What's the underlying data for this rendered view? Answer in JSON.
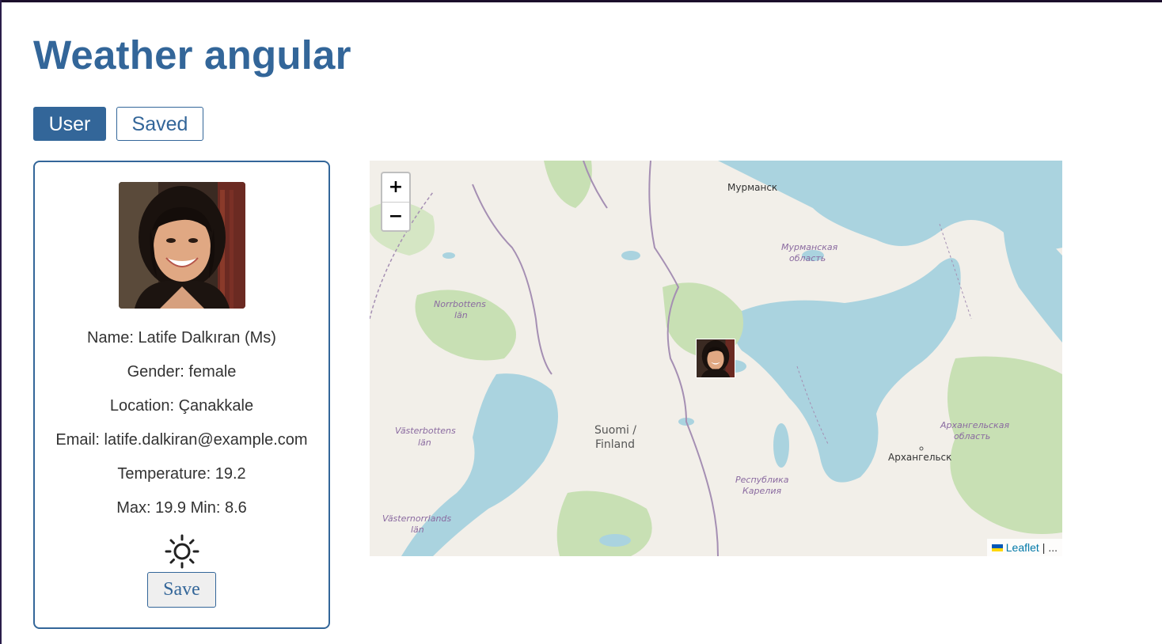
{
  "app": {
    "title": "Weather angular"
  },
  "tabs": {
    "user": "User",
    "saved": "Saved"
  },
  "user": {
    "name": "Name: Latife Dalkıran (Ms)",
    "gender": "Gender: female",
    "location": "Location: Çanakkale",
    "email": "Email: latife.dalkiran@example.com",
    "temperature": "Temperature: 19.2",
    "maxmin": "Max: 19.9 Min: 8.6",
    "weather_icon": "sun-icon",
    "save_label": "Save"
  },
  "map": {
    "zoom_in": "+",
    "zoom_out": "−",
    "attribution_link": "Leaflet",
    "attribution_rest": "| ...",
    "labels": {
      "murmansk": "Мурманск",
      "murmansk_oblast_1": "Мурманская",
      "murmansk_oblast_2": "область",
      "norrbotten_1": "Norrbottens",
      "norrbotten_2": "län",
      "vasterbotten_1": "Västerbottens",
      "vasterbotten_2": "län",
      "vasternorrland_1": "Västernorrlands",
      "vasternorrland_2": "län",
      "finland_1": "Suomi /",
      "finland_2": "Finland",
      "karelia_1": "Республика",
      "karelia_2": "Карелия",
      "arkhangelsk_oblast_1": "Архангельская",
      "arkhangelsk_oblast_2": "область",
      "arkhangelsk": "Архангельск"
    },
    "colors": {
      "water": "#aad3df",
      "land": "#f2efe9",
      "forest": "#c8e0b4",
      "border": "#a58fb3"
    }
  },
  "colors": {
    "accent": "#336699"
  }
}
